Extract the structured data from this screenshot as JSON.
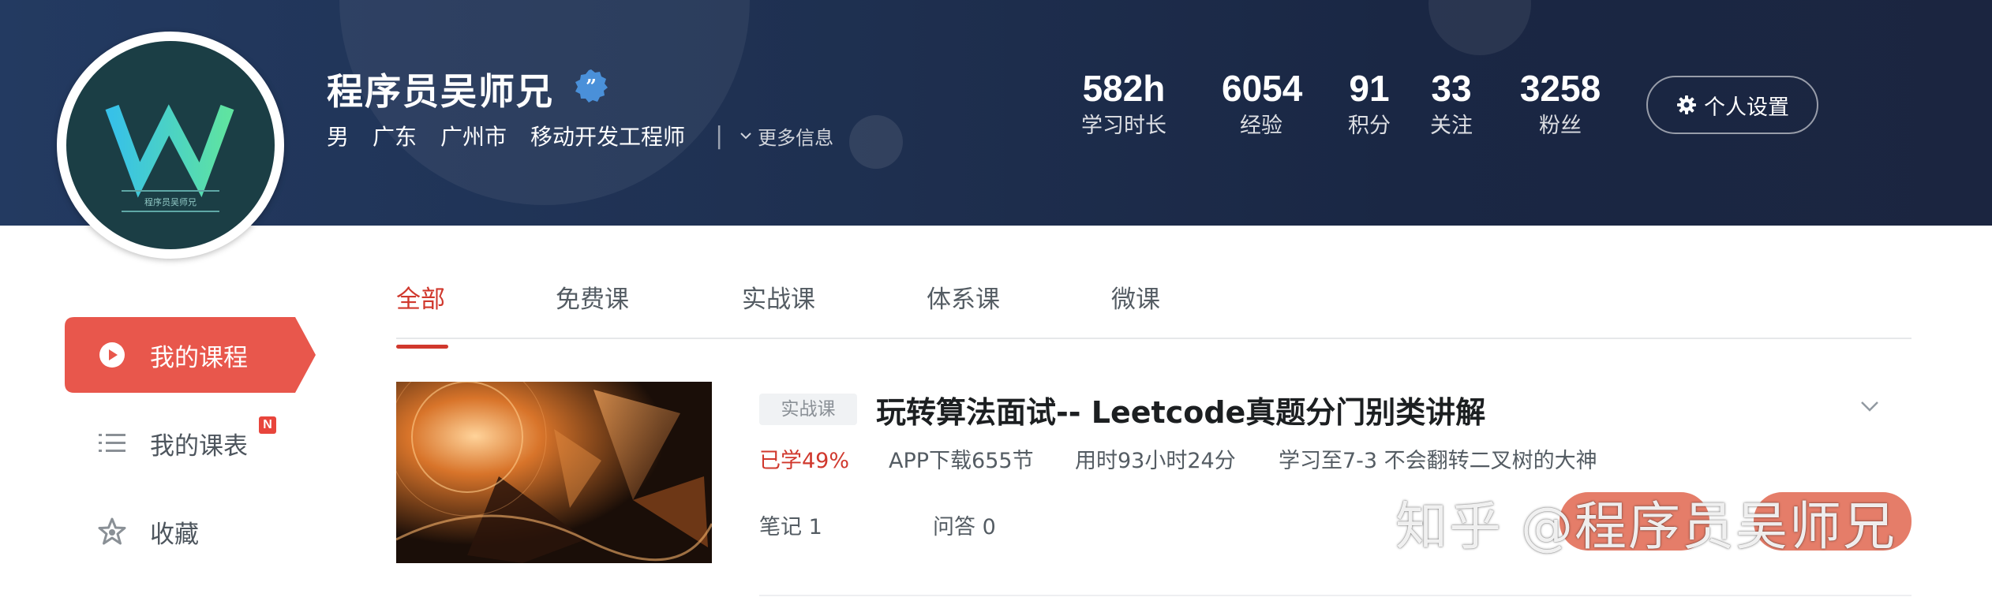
{
  "profile": {
    "name": "程序员吴师兄",
    "avatar_text": "程序员吴师兄",
    "gender": "男",
    "province": "广东",
    "city": "广州市",
    "job": "移动开发工程师",
    "separator": "|",
    "more_info": "更多信息"
  },
  "stats": [
    {
      "value": "582h",
      "label": "学习时长"
    },
    {
      "value": "6054",
      "label": "经验"
    },
    {
      "value": "91",
      "label": "积分"
    },
    {
      "value": "33",
      "label": "关注"
    },
    {
      "value": "3258",
      "label": "粉丝"
    }
  ],
  "settings_label": "个人设置",
  "sidebar": {
    "items": [
      {
        "label": "我的课程",
        "icon": "play-circle-icon",
        "active": true
      },
      {
        "label": "我的课表",
        "icon": "list-icon",
        "badge": "N"
      },
      {
        "label": "收藏",
        "icon": "star-icon"
      }
    ]
  },
  "tabs": [
    "全部",
    "免费课",
    "实战课",
    "体系课",
    "微课"
  ],
  "course": {
    "tag": "实战课",
    "title": "玩转算法面试-- Leetcode真题分门别类讲解",
    "progress": "已学49%",
    "download": "APP下载655节",
    "time": "用时93小时24分",
    "study_to": "学习至7-3 不会翻转二叉树的大神",
    "notes": "笔记 1",
    "qa": "问答 0"
  },
  "watermark": "知乎 @程序员吴师兄",
  "colors": {
    "accent_red": "#d0382d",
    "sidebar_active": "#e8574c",
    "banner": "#1e2f4f"
  }
}
